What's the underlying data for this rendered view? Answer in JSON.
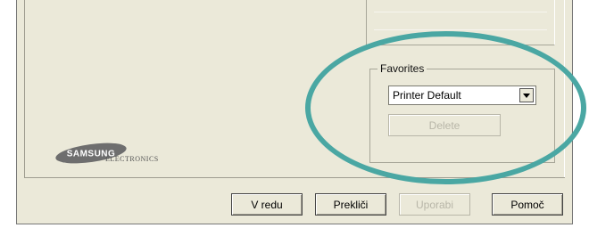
{
  "favorites": {
    "legend": "Favorites",
    "selected": "Printer Default",
    "delete_label": "Delete"
  },
  "logo": {
    "brand": "SAMSUNG",
    "tagline": "ELECTRONICS"
  },
  "buttons": {
    "ok_label": "V redu",
    "cancel_label": "Prekliči",
    "apply_label": "Uporabi",
    "help_label": "Pomoč"
  },
  "highlight_color": "#4aa7a3"
}
